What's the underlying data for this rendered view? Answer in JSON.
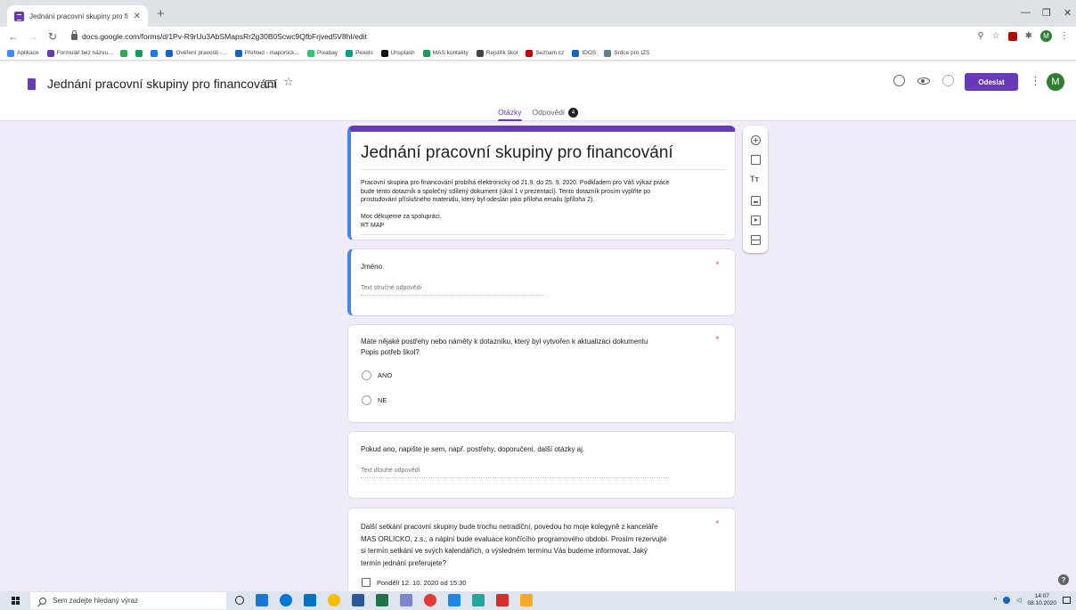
{
  "browser": {
    "tab_title": "Jednání pracovní skupiny pro fin",
    "url": "docs.google.com/forms/d/1Pv-R9rUu3AbSMapsRr2g30B0Scwc9QfbFrjved5V8hI/edit",
    "bookmarks": [
      {
        "label": "Aplikace",
        "color": "#4285f4"
      },
      {
        "label": "Formulář bez názvu...",
        "color": "#673ab7"
      },
      {
        "label": "",
        "color": "#34a853"
      },
      {
        "label": "",
        "color": "#0f9d58"
      },
      {
        "label": "",
        "color": "#1877f2"
      },
      {
        "label": "Ověření pravosti -...",
        "color": "#1565c0"
      },
      {
        "label": "Přehled - maporlick...",
        "color": "#1565c0"
      },
      {
        "label": "Pixabay",
        "color": "#2ec66d"
      },
      {
        "label": "Pexels",
        "color": "#05a081"
      },
      {
        "label": "Unsplash",
        "color": "#111111"
      },
      {
        "label": "MAS kontakty",
        "color": "#0f9d58"
      },
      {
        "label": "Rejstřík škol",
        "color": "#444444"
      },
      {
        "label": "Seznam.cz",
        "color": "#cc0000"
      },
      {
        "label": "IDOS",
        "color": "#1565c0"
      },
      {
        "label": "Srdce pro IZS",
        "color": "#607d8b"
      }
    ]
  },
  "header": {
    "doc_title": "Jednání pracovní skupiny pro financování",
    "send_label": "Odeslat",
    "avatar_letter": "M",
    "tabs": {
      "questions": "Otázky",
      "responses": "Odpovědi",
      "responses_count": "4"
    }
  },
  "form": {
    "title": "Jednání pracovní skupiny pro financování",
    "description": "Pracovní skupina pro financování probíhá elektronicky od 21.9. do 25. 9. 2020. Podkladem pro Váš výkaz práce\nbude tento dotazník a společný sdílený dokument (úkol 1 v prezentaci). Tento dotazník prosím vyplňte po\nprostudování příslušného materiálu, který byl odeslán jako příloha emailu (příloha 2).\n\nMoc děkujeme za spolupráci.\nRT MAP",
    "questions": [
      {
        "title": "Jméno",
        "required": "*",
        "answer_placeholder": "Text stručné odpovědi"
      },
      {
        "title": "Máte nějaké postřehy nebo náměty k dotazníku, který byl vytvořen k aktualizaci dokumentu\nPopis potřeb škol?",
        "required": "*",
        "options": [
          "ANO",
          "NE"
        ]
      },
      {
        "title": "Pokud ano, napište je sem, např. postřehy, doporučení, další otázky aj.",
        "answer_placeholder": "Text dlouhé odpovědi"
      },
      {
        "title": "Další setkání pracovní skupiny bude trochu netradiční, povedou ho moje kolegyně z kanceláře\nMAS ORLICKO, z.s., a náplní bude evaluace končícího programového období. Prosím rezervujte\nsi termín setkání ve svých kalendářích, o výsledném termínu Vás budeme informovat. Jaký\ntermín jednání preferujete?",
        "required": "*",
        "options": [
          "Pondělí 12. 10. 2020 od 15:30"
        ]
      }
    ]
  },
  "taskbar": {
    "search_placeholder": "Sem zadejte hledaný výraz",
    "time": "14:07",
    "date": "08.10.2020"
  }
}
